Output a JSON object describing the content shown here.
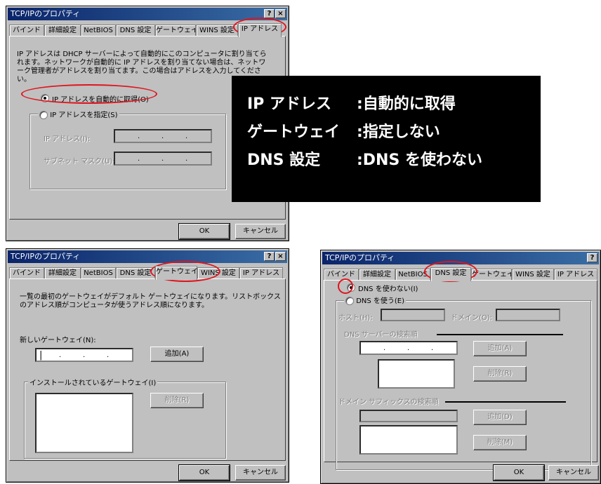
{
  "win1": {
    "title": "TCP/IPのプロパティ",
    "help_label": "?",
    "close_label": "×",
    "tabs": [
      "バインド",
      "詳細設定",
      "NetBIOS",
      "DNS 設定",
      "ゲートウェイ",
      "WINS 設定",
      "IP アドレス"
    ],
    "description": [
      "IP アドレスは DHCP サーバーによって自動的にこのコンピュータに割り当てら",
      "れます。ネットワークが自動的に IP アドレスを割り当てない場合は、ネットワ",
      "ーク管理者がアドレスを割り当てます。この場合はアドレスを入力してくださ",
      "い。"
    ],
    "radio_auto": "IP アドレスを自動的に取得(O)",
    "radio_specify": "IP アドレスを指定(S)",
    "ip_label": "IP アドレス(I):",
    "subnet_label": "サブネット マスク(U):",
    "dot": ".",
    "ok": "OK",
    "cancel": "キャンセル"
  },
  "overlay": {
    "rows": [
      {
        "label": "IP アドレス",
        "value": ":自動的に取得"
      },
      {
        "label": "ゲートウェイ",
        "value": ":指定しない"
      },
      {
        "label": "DNS 設定",
        "value": ":DNS を使わない"
      }
    ]
  },
  "win2": {
    "title": "TCP/IPのプロパティ",
    "help_label": "?",
    "close_label": "×",
    "tabs": [
      "バインド",
      "詳細設定",
      "NetBIOS",
      "DNS 設定",
      "ゲートウェイ",
      "WINS 設定",
      "IP アドレス"
    ],
    "description": [
      "一覧の最初のゲートウェイがデフォルト ゲートウェイになります。リストボックス",
      "のアドレス順がコンピュータが使うアドレス順になります。"
    ],
    "new_gateway_label": "新しいゲートウェイ(N):",
    "add": "追加(A)",
    "installed_label": "インストールされているゲートウェイ(I)",
    "remove": "削除(R)",
    "dot": ".",
    "ok": "OK",
    "cancel": "キャンセル"
  },
  "win3": {
    "title": "TCP/IPのプロパティ",
    "help_label": "?",
    "close_label": "×",
    "tabs": [
      "バインド",
      "詳細設定",
      "NetBIOS",
      "DNS 設定",
      "ゲートウェイ",
      "WINS 設定",
      "IP アドレス"
    ],
    "radio_no_dns": "DNS を使わない(I)",
    "radio_use_dns": "DNS を使う(E)",
    "host_label": "ホスト(H):",
    "domain_label": "ドメイン(O):",
    "dns_search_label": "DNS サーバーの検索順",
    "add_dns": "追加(A)",
    "remove_dns": "削除(R)",
    "suffix_search_label": "ドメイン サフィックスの検索順",
    "add_suffix": "追加(D)",
    "remove_suffix": "削除(M)",
    "dot": ".",
    "ok": "OK",
    "cancel": "キャンセル"
  },
  "colors": {
    "highlight_oval": "#e0141e",
    "title_bar": "#0a246a",
    "dialog_face": "#c0c0c0",
    "overlay_bg": "#000000"
  }
}
